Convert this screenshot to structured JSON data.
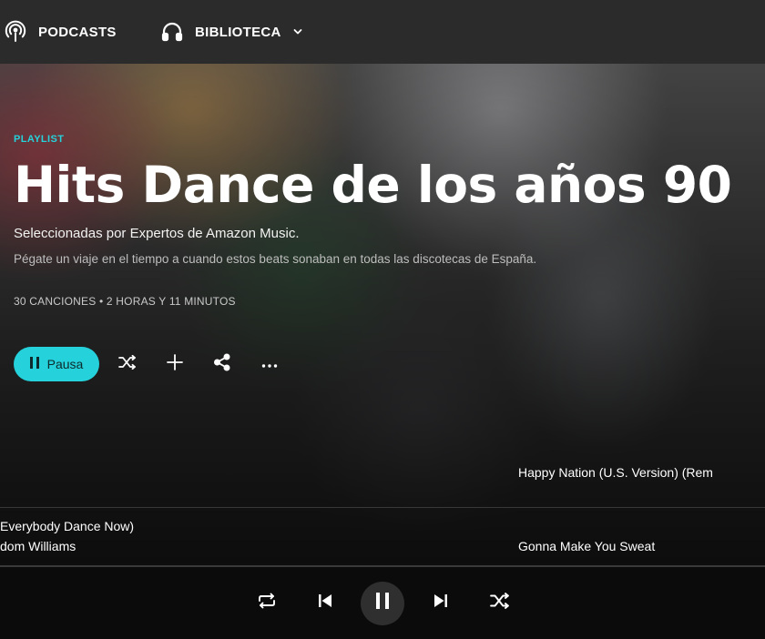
{
  "topnav": {
    "podcasts_label": "PODCASTS",
    "library_label": "BIBLIOTECA"
  },
  "hero": {
    "eyebrow": "PLAYLIST",
    "title": "Hits Dance de los años 90",
    "curator": "Seleccionadas por Expertos de Amazon Music.",
    "description": "Pégate un viaje en el tiempo a cuando estos beats sonaban en todas las discotecas de España.",
    "meta": "30 CANCIONES • 2 HORAS Y 11 MINUTOS",
    "pause_label": "Pausa"
  },
  "tracks": {
    "right_top": "Happy Nation (U.S. Version) (Rem",
    "left_title": "Everybody Dance Now)",
    "left_artist": "dom Williams",
    "right_bottom": "Gonna Make You Sweat"
  },
  "colors": {
    "accent": "#25d1da",
    "nav_bg": "#2b2b2b",
    "player_bg": "#0b0b0b"
  },
  "icons": {
    "podcasts": "podcast-icon",
    "library": "headphones-icon",
    "dropdown": "chevron-down-icon",
    "shuffle": "shuffle-icon",
    "add": "plus-icon",
    "share": "share-icon",
    "more": "more-icon",
    "repeat": "repeat-icon",
    "previous": "previous-icon",
    "pause": "pause-icon",
    "next": "next-icon"
  }
}
